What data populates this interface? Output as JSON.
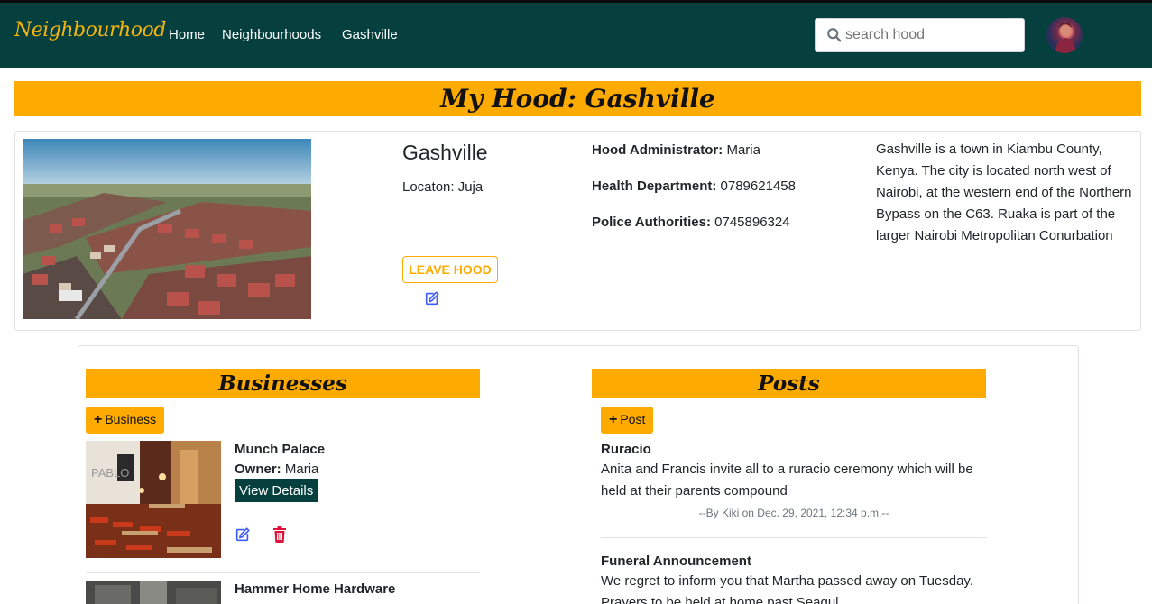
{
  "nav": {
    "brand": "Neighbourhood",
    "links": [
      "Home",
      "Neighbourhoods",
      "Gashville"
    ],
    "search_placeholder": "search hood"
  },
  "page_title": "My Hood: Gashville",
  "hood": {
    "name": "Gashville",
    "location_label": "Locaton:",
    "location": "Juja",
    "leave_label": "LEAVE HOOD",
    "admin_label": "Hood Administrator:",
    "admin": "Maria",
    "health_label": "Health Department:",
    "health": "0789621458",
    "police_label": "Police Authorities:",
    "police": "0745896324",
    "description": "Gashville is a town in Kiambu County, Kenya. The city is located north west of Nairobi, at the western end of the Northern Bypass on the C63. Ruaka is part of the larger Nairobi Metropolitan Conurbation"
  },
  "businesses": {
    "header": "Businesses",
    "add_label": "Business",
    "items": [
      {
        "name": "Munch Palace",
        "owner_label": "Owner:",
        "owner": "Maria",
        "details_label": "View Details"
      },
      {
        "name": "Hammer Home Hardware"
      }
    ]
  },
  "posts": {
    "header": "Posts",
    "add_label": "Post",
    "items": [
      {
        "title": "Ruracio",
        "body": "Anita and Francis invite all to a ruracio ceremony which will be held at their parents compound",
        "meta": "--By Kiki on Dec. 29, 2021, 12:34 p.m.--"
      },
      {
        "title": "Funeral Announcement",
        "body": "We regret to inform you that Martha passed away on Tuesday. Prayers to be held at home past Seagul"
      }
    ]
  },
  "colors": {
    "nav_bg": "#05403f",
    "accent": "#fdab00",
    "brand": "#f6b40e",
    "edit": "#3d5afe",
    "delete": "#dc143c"
  }
}
